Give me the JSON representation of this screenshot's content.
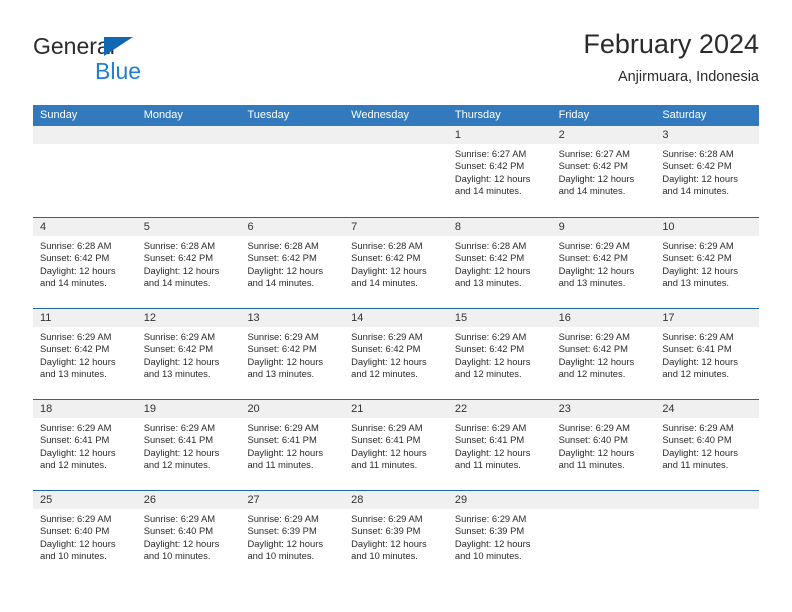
{
  "brand": {
    "name_top": "General",
    "name_bottom": "Blue",
    "triangle_color": "#1267b2",
    "blue_color": "#1f7fd4"
  },
  "header": {
    "title": "February 2024",
    "subtitle": "Anjirmuara, Indonesia"
  },
  "theme": {
    "header_blue": "#3279bd",
    "rule_blue": "#1f66ad",
    "daynum_band": "#f0f0f0"
  },
  "weekdays": [
    "Sunday",
    "Monday",
    "Tuesday",
    "Wednesday",
    "Thursday",
    "Friday",
    "Saturday"
  ],
  "weeks": [
    [
      {
        "day": "",
        "empty": true
      },
      {
        "day": "",
        "empty": true
      },
      {
        "day": "",
        "empty": true
      },
      {
        "day": "",
        "empty": true
      },
      {
        "day": "1",
        "sunrise": "Sunrise: 6:27 AM",
        "sunset": "Sunset: 6:42 PM",
        "daylight1": "Daylight: 12 hours",
        "daylight2": "and 14 minutes."
      },
      {
        "day": "2",
        "sunrise": "Sunrise: 6:27 AM",
        "sunset": "Sunset: 6:42 PM",
        "daylight1": "Daylight: 12 hours",
        "daylight2": "and 14 minutes."
      },
      {
        "day": "3",
        "sunrise": "Sunrise: 6:28 AM",
        "sunset": "Sunset: 6:42 PM",
        "daylight1": "Daylight: 12 hours",
        "daylight2": "and 14 minutes."
      }
    ],
    [
      {
        "day": "4",
        "sunrise": "Sunrise: 6:28 AM",
        "sunset": "Sunset: 6:42 PM",
        "daylight1": "Daylight: 12 hours",
        "daylight2": "and 14 minutes."
      },
      {
        "day": "5",
        "sunrise": "Sunrise: 6:28 AM",
        "sunset": "Sunset: 6:42 PM",
        "daylight1": "Daylight: 12 hours",
        "daylight2": "and 14 minutes."
      },
      {
        "day": "6",
        "sunrise": "Sunrise: 6:28 AM",
        "sunset": "Sunset: 6:42 PM",
        "daylight1": "Daylight: 12 hours",
        "daylight2": "and 14 minutes."
      },
      {
        "day": "7",
        "sunrise": "Sunrise: 6:28 AM",
        "sunset": "Sunset: 6:42 PM",
        "daylight1": "Daylight: 12 hours",
        "daylight2": "and 14 minutes."
      },
      {
        "day": "8",
        "sunrise": "Sunrise: 6:28 AM",
        "sunset": "Sunset: 6:42 PM",
        "daylight1": "Daylight: 12 hours",
        "daylight2": "and 13 minutes."
      },
      {
        "day": "9",
        "sunrise": "Sunrise: 6:29 AM",
        "sunset": "Sunset: 6:42 PM",
        "daylight1": "Daylight: 12 hours",
        "daylight2": "and 13 minutes."
      },
      {
        "day": "10",
        "sunrise": "Sunrise: 6:29 AM",
        "sunset": "Sunset: 6:42 PM",
        "daylight1": "Daylight: 12 hours",
        "daylight2": "and 13 minutes."
      }
    ],
    [
      {
        "day": "11",
        "sunrise": "Sunrise: 6:29 AM",
        "sunset": "Sunset: 6:42 PM",
        "daylight1": "Daylight: 12 hours",
        "daylight2": "and 13 minutes."
      },
      {
        "day": "12",
        "sunrise": "Sunrise: 6:29 AM",
        "sunset": "Sunset: 6:42 PM",
        "daylight1": "Daylight: 12 hours",
        "daylight2": "and 13 minutes."
      },
      {
        "day": "13",
        "sunrise": "Sunrise: 6:29 AM",
        "sunset": "Sunset: 6:42 PM",
        "daylight1": "Daylight: 12 hours",
        "daylight2": "and 13 minutes."
      },
      {
        "day": "14",
        "sunrise": "Sunrise: 6:29 AM",
        "sunset": "Sunset: 6:42 PM",
        "daylight1": "Daylight: 12 hours",
        "daylight2": "and 12 minutes."
      },
      {
        "day": "15",
        "sunrise": "Sunrise: 6:29 AM",
        "sunset": "Sunset: 6:42 PM",
        "daylight1": "Daylight: 12 hours",
        "daylight2": "and 12 minutes."
      },
      {
        "day": "16",
        "sunrise": "Sunrise: 6:29 AM",
        "sunset": "Sunset: 6:42 PM",
        "daylight1": "Daylight: 12 hours",
        "daylight2": "and 12 minutes."
      },
      {
        "day": "17",
        "sunrise": "Sunrise: 6:29 AM",
        "sunset": "Sunset: 6:41 PM",
        "daylight1": "Daylight: 12 hours",
        "daylight2": "and 12 minutes."
      }
    ],
    [
      {
        "day": "18",
        "sunrise": "Sunrise: 6:29 AM",
        "sunset": "Sunset: 6:41 PM",
        "daylight1": "Daylight: 12 hours",
        "daylight2": "and 12 minutes."
      },
      {
        "day": "19",
        "sunrise": "Sunrise: 6:29 AM",
        "sunset": "Sunset: 6:41 PM",
        "daylight1": "Daylight: 12 hours",
        "daylight2": "and 12 minutes."
      },
      {
        "day": "20",
        "sunrise": "Sunrise: 6:29 AM",
        "sunset": "Sunset: 6:41 PM",
        "daylight1": "Daylight: 12 hours",
        "daylight2": "and 11 minutes."
      },
      {
        "day": "21",
        "sunrise": "Sunrise: 6:29 AM",
        "sunset": "Sunset: 6:41 PM",
        "daylight1": "Daylight: 12 hours",
        "daylight2": "and 11 minutes."
      },
      {
        "day": "22",
        "sunrise": "Sunrise: 6:29 AM",
        "sunset": "Sunset: 6:41 PM",
        "daylight1": "Daylight: 12 hours",
        "daylight2": "and 11 minutes."
      },
      {
        "day": "23",
        "sunrise": "Sunrise: 6:29 AM",
        "sunset": "Sunset: 6:40 PM",
        "daylight1": "Daylight: 12 hours",
        "daylight2": "and 11 minutes."
      },
      {
        "day": "24",
        "sunrise": "Sunrise: 6:29 AM",
        "sunset": "Sunset: 6:40 PM",
        "daylight1": "Daylight: 12 hours",
        "daylight2": "and 11 minutes."
      }
    ],
    [
      {
        "day": "25",
        "sunrise": "Sunrise: 6:29 AM",
        "sunset": "Sunset: 6:40 PM",
        "daylight1": "Daylight: 12 hours",
        "daylight2": "and 10 minutes."
      },
      {
        "day": "26",
        "sunrise": "Sunrise: 6:29 AM",
        "sunset": "Sunset: 6:40 PM",
        "daylight1": "Daylight: 12 hours",
        "daylight2": "and 10 minutes."
      },
      {
        "day": "27",
        "sunrise": "Sunrise: 6:29 AM",
        "sunset": "Sunset: 6:39 PM",
        "daylight1": "Daylight: 12 hours",
        "daylight2": "and 10 minutes."
      },
      {
        "day": "28",
        "sunrise": "Sunrise: 6:29 AM",
        "sunset": "Sunset: 6:39 PM",
        "daylight1": "Daylight: 12 hours",
        "daylight2": "and 10 minutes."
      },
      {
        "day": "29",
        "sunrise": "Sunrise: 6:29 AM",
        "sunset": "Sunset: 6:39 PM",
        "daylight1": "Daylight: 12 hours",
        "daylight2": "and 10 minutes."
      },
      {
        "day": "",
        "empty": true
      },
      {
        "day": "",
        "empty": true
      }
    ]
  ]
}
